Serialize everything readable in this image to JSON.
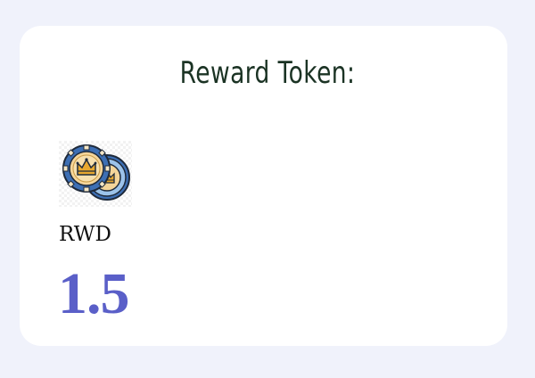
{
  "card": {
    "title": "Reward Token:",
    "token": {
      "icon": "crown-coins-icon",
      "symbol": "RWD",
      "amount": "1.5"
    }
  },
  "colors": {
    "page_background": "#f0f2fb",
    "card_background": "#ffffff",
    "title_text": "#1b3324",
    "amount_text": "#5a5fc8"
  }
}
